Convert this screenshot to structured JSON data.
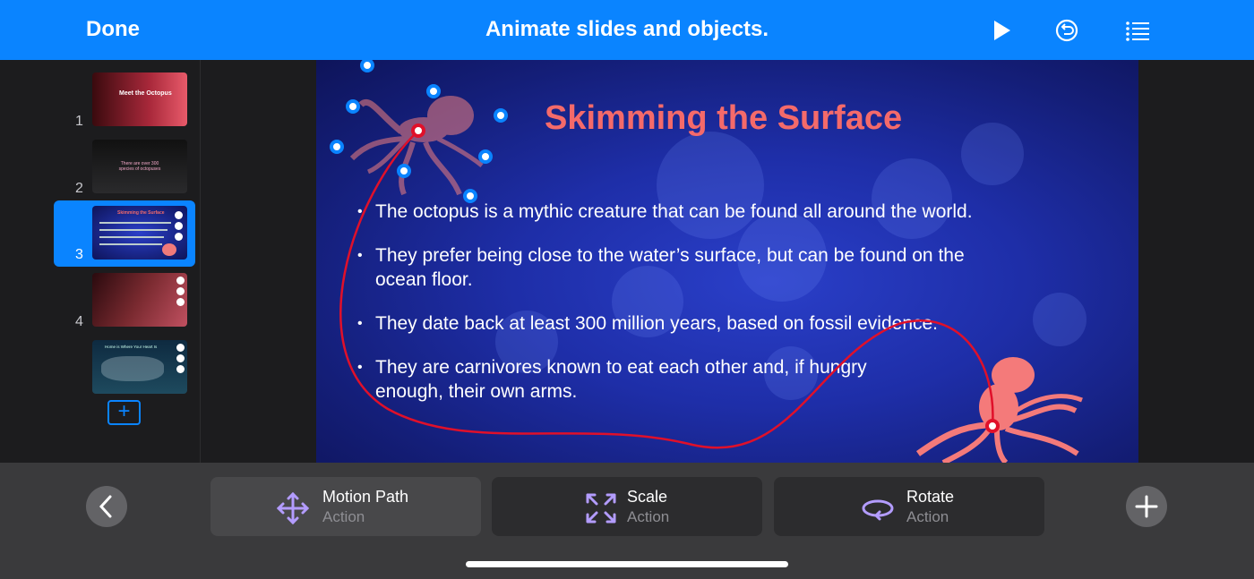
{
  "topbar": {
    "done_label": "Done",
    "title": "Animate slides and objects.",
    "play_icon": "play-icon",
    "undo_icon": "undo-icon",
    "list_icon": "list-icon"
  },
  "sidebar": {
    "slides": [
      {
        "number": "1",
        "thumb_title": "Meet the Octopus",
        "selected": false
      },
      {
        "number": "2",
        "thumb_title": "There are over 300 species of octopuses",
        "selected": false
      },
      {
        "number": "3",
        "thumb_title": "Skimming the Surface",
        "selected": true
      },
      {
        "number": "4",
        "thumb_title": "",
        "selected": false
      },
      {
        "number": "",
        "thumb_title": "Home is Where Your Heart Is",
        "selected": false
      }
    ],
    "add_label": "+"
  },
  "slide": {
    "title": "Skimming the Surface",
    "bullets": [
      "The octopus is a mythic creature that can be found all around the world.",
      "They prefer being close to the water’s surface, but can be found on the ocean floor.",
      "They date back at least 300 million years, based on fossil evidence.",
      "They are carnivores known to eat each other and, if hungry enough, their own arms."
    ]
  },
  "actions": [
    {
      "label": "Motion Path",
      "sublabel": "Action",
      "icon": "move-arrows-icon",
      "active": true
    },
    {
      "label": "Scale",
      "sublabel": "Action",
      "icon": "scale-icon",
      "active": false
    },
    {
      "label": "Rotate",
      "sublabel": "Action",
      "icon": "rotate-icon",
      "active": false
    }
  ],
  "bottombar": {
    "back_icon": "chevron-left-icon",
    "add_icon": "plus-icon"
  },
  "colors": {
    "accent": "#0a84ff",
    "title_coral": "#f46a6a",
    "path_red": "#e0102a",
    "action_icon": "#b39cff"
  }
}
